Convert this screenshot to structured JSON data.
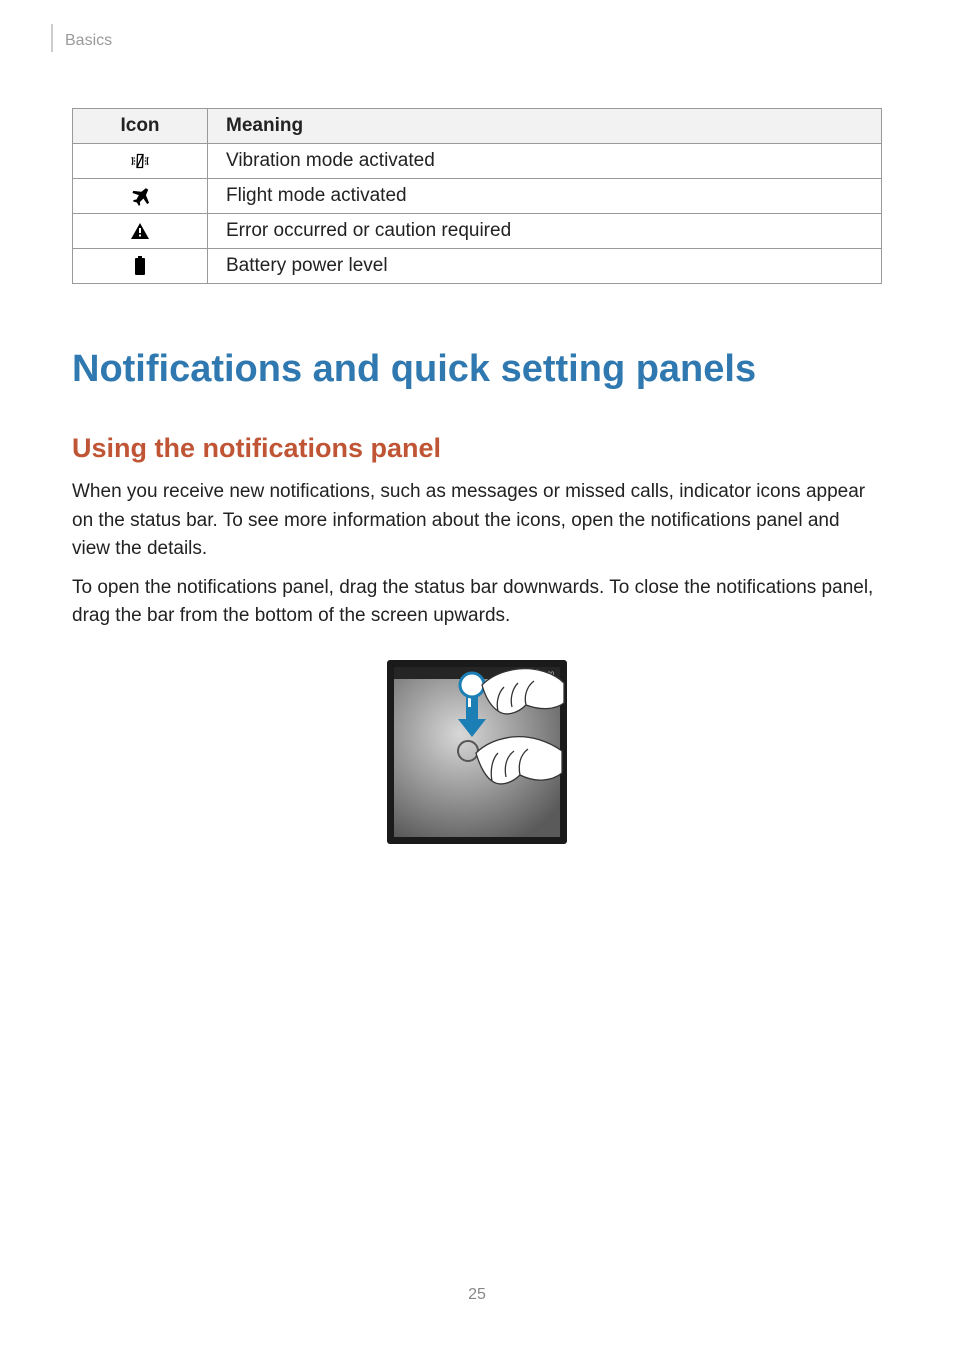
{
  "header": {
    "breadcrumb": "Basics"
  },
  "table": {
    "headers": {
      "icon": "Icon",
      "meaning": "Meaning"
    },
    "rows": [
      {
        "icon_name": "vibration-icon",
        "meaning": "Vibration mode activated"
      },
      {
        "icon_name": "flight-mode-icon",
        "meaning": "Flight mode activated"
      },
      {
        "icon_name": "warning-icon",
        "meaning": "Error occurred or caution required"
      },
      {
        "icon_name": "battery-icon",
        "meaning": "Battery power level"
      }
    ]
  },
  "section_title": "Notifications and quick setting panels",
  "sub_title": "Using the notifications panel",
  "paragraphs": [
    "When you receive new notifications, such as messages or missed calls, indicator icons appear on the status bar. To see more information about the icons, open the notifications panel and view the details.",
    "To open the notifications panel, drag the status bar downwards. To close the notifications panel, drag the bar from the bottom of the screen upwards."
  ],
  "illustration": {
    "status_time": "10:00"
  },
  "page_number": "25"
}
